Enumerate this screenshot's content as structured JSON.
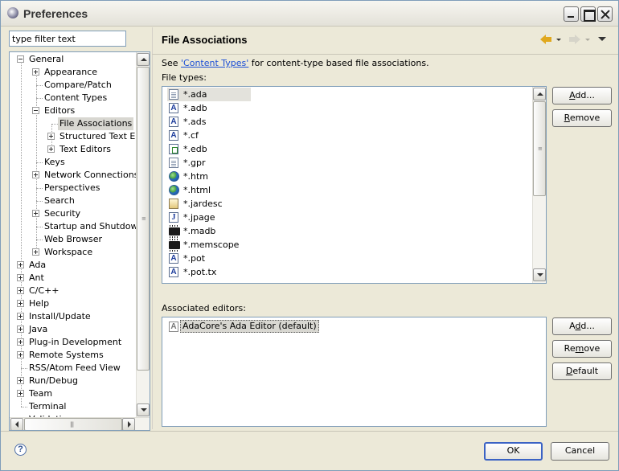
{
  "window": {
    "title": "Preferences"
  },
  "filter": {
    "value": "type filter text"
  },
  "tree": {
    "items": [
      {
        "label": "General",
        "level": 0,
        "expander": "minus"
      },
      {
        "label": "Appearance",
        "level": 1,
        "expander": "plus"
      },
      {
        "label": "Compare/Patch",
        "level": 1,
        "expander": "none"
      },
      {
        "label": "Content Types",
        "level": 1,
        "expander": "none"
      },
      {
        "label": "Editors",
        "level": 1,
        "expander": "minus"
      },
      {
        "label": "File Associations",
        "level": 2,
        "expander": "none",
        "selected": true
      },
      {
        "label": "Structured Text Editors",
        "level": 2,
        "expander": "plus"
      },
      {
        "label": "Text Editors",
        "level": 2,
        "expander": "plus"
      },
      {
        "label": "Keys",
        "level": 1,
        "expander": "none"
      },
      {
        "label": "Network Connections",
        "level": 1,
        "expander": "plus"
      },
      {
        "label": "Perspectives",
        "level": 1,
        "expander": "none"
      },
      {
        "label": "Search",
        "level": 1,
        "expander": "none"
      },
      {
        "label": "Security",
        "level": 1,
        "expander": "plus"
      },
      {
        "label": "Startup and Shutdown",
        "level": 1,
        "expander": "none"
      },
      {
        "label": "Web Browser",
        "level": 1,
        "expander": "none"
      },
      {
        "label": "Workspace",
        "level": 1,
        "expander": "plus"
      },
      {
        "label": "Ada",
        "level": 0,
        "expander": "plus"
      },
      {
        "label": "Ant",
        "level": 0,
        "expander": "plus"
      },
      {
        "label": "C/C++",
        "level": 0,
        "expander": "plus"
      },
      {
        "label": "Help",
        "level": 0,
        "expander": "plus"
      },
      {
        "label": "Install/Update",
        "level": 0,
        "expander": "plus"
      },
      {
        "label": "Java",
        "level": 0,
        "expander": "plus"
      },
      {
        "label": "Plug-in Development",
        "level": 0,
        "expander": "plus"
      },
      {
        "label": "Remote Systems",
        "level": 0,
        "expander": "plus"
      },
      {
        "label": "RSS/Atom Feed View",
        "level": 0,
        "expander": "none"
      },
      {
        "label": "Run/Debug",
        "level": 0,
        "expander": "plus"
      },
      {
        "label": "Team",
        "level": 0,
        "expander": "plus"
      },
      {
        "label": "Terminal",
        "level": 0,
        "expander": "none"
      },
      {
        "label": "Validation",
        "level": 0,
        "expander": "none"
      }
    ]
  },
  "page": {
    "title": "File Associations",
    "see_prefix": "See ",
    "see_link": "'Content Types'",
    "see_suffix": " for content-type based file associations.",
    "file_types_label": "File types:",
    "associated_editors_label": "Associated editors:"
  },
  "file_types": [
    {
      "name": "*.ada",
      "icon": "doc-icon",
      "selected": true
    },
    {
      "name": "*.adb",
      "icon": "ada-icon"
    },
    {
      "name": "*.ads",
      "icon": "ada-icon"
    },
    {
      "name": "*.cf",
      "icon": "ada-icon"
    },
    {
      "name": "*.edb",
      "icon": "edb-icon"
    },
    {
      "name": "*.gpr",
      "icon": "doc-icon"
    },
    {
      "name": "*.htm",
      "icon": "globe-icon"
    },
    {
      "name": "*.html",
      "icon": "globe-icon"
    },
    {
      "name": "*.jardesc",
      "icon": "jar-icon"
    },
    {
      "name": "*.jpage",
      "icon": "java-icon"
    },
    {
      "name": "*.madb",
      "icon": "chip-icon"
    },
    {
      "name": "*.memscope",
      "icon": "chip-icon"
    },
    {
      "name": "*.pot",
      "icon": "ada-icon"
    },
    {
      "name": "*.pot.tx",
      "icon": "ada-icon"
    }
  ],
  "associated_editors": [
    {
      "name": "AdaCore's Ada Editor (default)",
      "icon": "ada-icon"
    }
  ],
  "buttons": {
    "add_file": {
      "u": "A",
      "rest": "dd..."
    },
    "remove_file": {
      "u": "R",
      "rest": "emove"
    },
    "add_editor": {
      "pre": "A",
      "u": "d",
      "rest": "d..."
    },
    "remove_editor": {
      "pre": "Re",
      "u": "m",
      "rest": "ove"
    },
    "default_editor": {
      "pre": "",
      "u": "D",
      "rest": "efault"
    },
    "ok": "OK",
    "cancel": "Cancel",
    "help": "?"
  },
  "colors": {
    "link": "#1c4fd6",
    "default_button_border": "#3a62c4",
    "selection": "#d8d7d1"
  }
}
